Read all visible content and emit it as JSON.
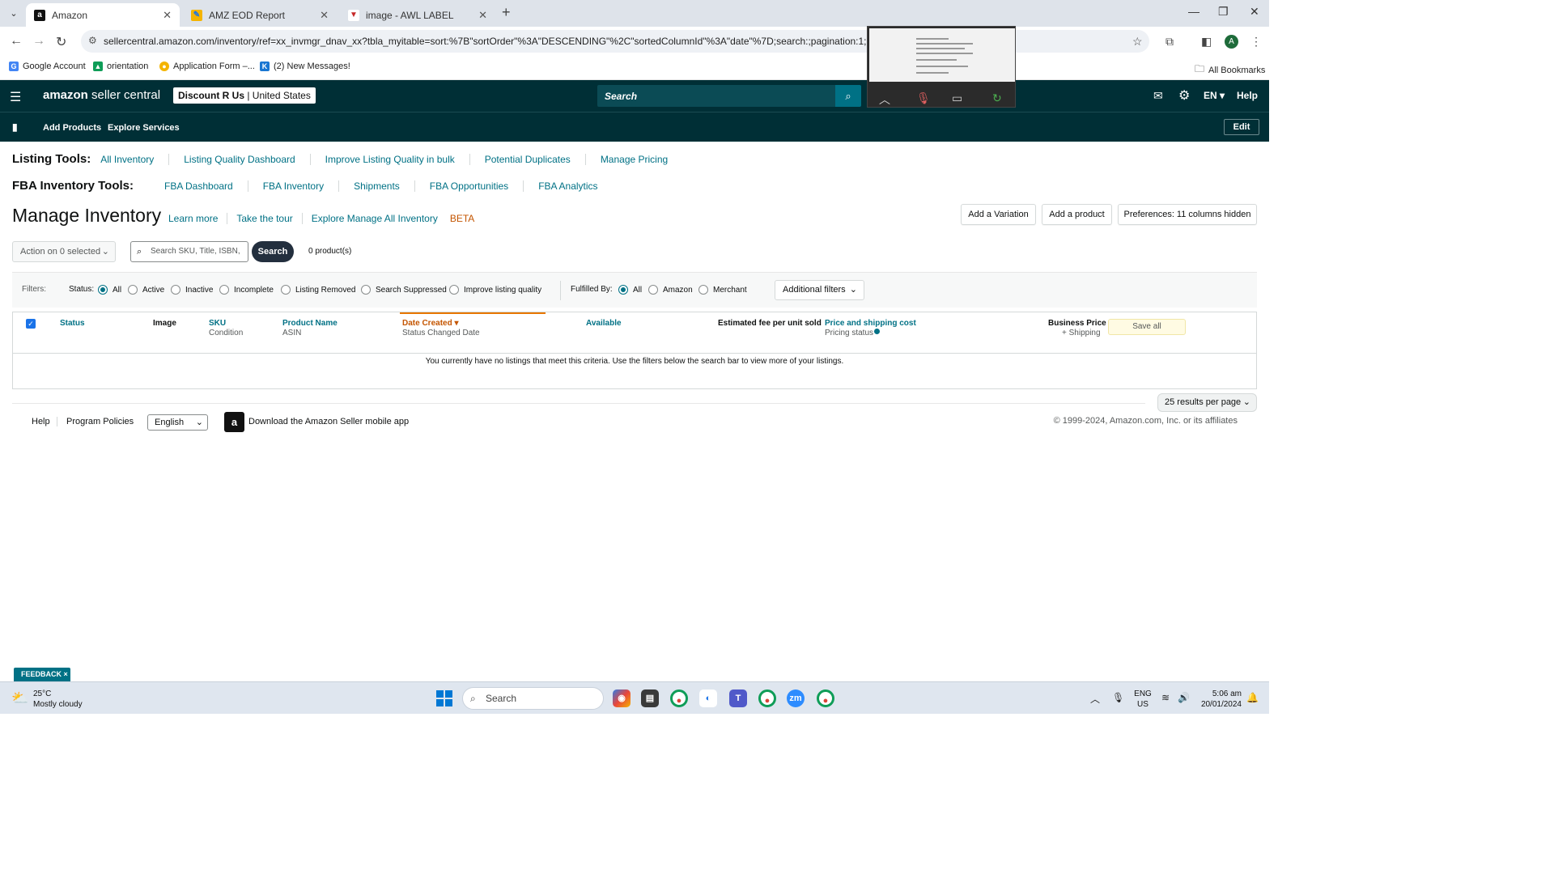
{
  "browser": {
    "tabs": [
      {
        "label": "Amazon",
        "active": true
      },
      {
        "label": "AMZ EOD Report",
        "active": false
      },
      {
        "label": "image - AWL LABEL",
        "active": false
      }
    ],
    "url": "sellercentral.amazon.com/inventory/ref=xx_invmgr_dnav_xx?tbla_myitable=sort:%7B\"sortOrder\"%3A\"DESCENDING\"%2C\"sortedColumnId\"%3A\"date\"%7D;search:;pagination:1;",
    "avatar_letter": "A",
    "bookmarks": [
      "Google Account",
      "orientation",
      "Application Form –...",
      "(2) New Messages!"
    ],
    "all_bookmarks": "All Bookmarks"
  },
  "header": {
    "logo_main": "amazon",
    "logo_sub": " seller central",
    "account_name": "Discount R Us",
    "account_region": " | United States",
    "search_placeholder": "Search",
    "language": "EN ▾",
    "help": "Help"
  },
  "subbar": {
    "items": [
      "Add Products",
      "Explore Services"
    ],
    "edit": "Edit"
  },
  "listing_tools": {
    "label": "Listing Tools:",
    "links": [
      "All Inventory",
      "Listing Quality Dashboard",
      "Improve Listing Quality in bulk",
      "Potential Duplicates",
      "Manage Pricing"
    ]
  },
  "fba_tools": {
    "label": "FBA Inventory Tools:",
    "links": [
      "FBA Dashboard",
      "FBA Inventory",
      "Shipments",
      "FBA Opportunities",
      "FBA Analytics"
    ]
  },
  "page": {
    "title": "Manage Inventory",
    "learn_more": "Learn more",
    "take_tour": "Take the tour",
    "explore": "Explore Manage All Inventory",
    "beta": "BETA",
    "add_variation": "Add a Variation",
    "add_product": "Add a product",
    "preferences": "Preferences: 11 columns hidden",
    "action_select": "Action on 0 selected",
    "search_placeholder": "Search SKU, Title, ISBN,",
    "search_button": "Search",
    "product_count": "0 product(s)"
  },
  "filters": {
    "label": "Filters:",
    "status_label": "Status:",
    "status_options": [
      "All",
      "Active",
      "Inactive",
      "Incomplete",
      "Listing Removed",
      "Search Suppressed",
      "Improve listing quality"
    ],
    "fulfilled_label": "Fulfilled By:",
    "fulfilled_options": [
      "All",
      "Amazon",
      "Merchant"
    ],
    "additional": "Additional filters"
  },
  "table": {
    "col_status": "Status",
    "col_image": "Image",
    "col_sku": "SKU",
    "col_condition": "Condition",
    "col_product": "Product Name",
    "col_asin": "ASIN",
    "col_date": "Date Created",
    "col_status_changed": "Status Changed Date",
    "col_available": "Available",
    "col_fee": "Estimated fee per unit sold",
    "col_price": "Price and shipping cost",
    "col_pricing_status": "Pricing status",
    "col_business": "Business Price",
    "col_shipping": "+ Shipping",
    "save_all": "Save all",
    "empty": "You currently have no listings that meet this criteria. Use the filters below the search bar to view more of your listings."
  },
  "pagination": {
    "per_page": "25 results per page"
  },
  "footer": {
    "help": "Help",
    "policies": "Program Policies",
    "language": "English",
    "app": "Download the Amazon Seller mobile app",
    "copyright": "© 1999-2024, Amazon.com, Inc. or its affiliates"
  },
  "feedback": "FEEDBACK ×",
  "taskbar": {
    "temp": "25°C",
    "weather": "Mostly cloudy",
    "search": "Search",
    "lang1": "ENG",
    "lang2": "US",
    "time": "5:06 am",
    "date": "20/01/2024"
  },
  "colors": {
    "header_bg": "#002f36",
    "link": "#007185",
    "accent": "#c45500"
  }
}
